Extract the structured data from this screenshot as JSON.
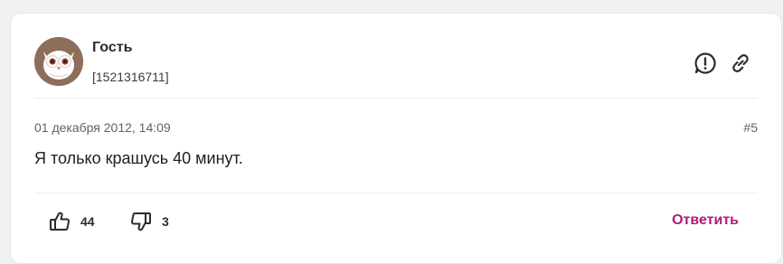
{
  "author": {
    "name": "Гость",
    "id": "[1521316711]",
    "avatar_icon": "owl-avatar-icon"
  },
  "actions": {
    "report_icon": "exclamation-circle-icon",
    "link_icon": "chain-link-icon"
  },
  "post": {
    "date": "01 декабря 2012, 14:09",
    "number": "#5",
    "text": "Я только крашусь 40 минут."
  },
  "votes": {
    "likes": "44",
    "dislikes": "3",
    "like_icon": "thumbs-up-icon",
    "dislike_icon": "thumbs-down-icon"
  },
  "reply": {
    "label": "Ответить"
  },
  "colors": {
    "accent": "#b0197a",
    "avatar_bg": "#8c6e5a",
    "text": "#1e1e24"
  }
}
